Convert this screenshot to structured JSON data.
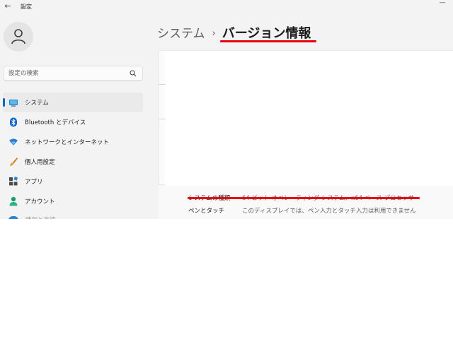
{
  "window": {
    "title": "設定",
    "back_glyph": "←",
    "minimize_glyph": "—"
  },
  "search": {
    "placeholder": "設定の検索"
  },
  "sidebar": {
    "items": [
      {
        "label": "システム",
        "icon": "monitor-icon",
        "selected": true
      },
      {
        "label": "Bluetooth とデバイス",
        "icon": "bluetooth-icon"
      },
      {
        "label": "ネットワークとインターネット",
        "icon": "wifi-icon"
      },
      {
        "label": "個人用設定",
        "icon": "brush-icon"
      },
      {
        "label": "アプリ",
        "icon": "apps-icon"
      },
      {
        "label": "アカウント",
        "icon": "person-icon"
      },
      {
        "label": "時刻と言語",
        "icon": "clock-globe-icon"
      }
    ]
  },
  "breadcrumb": {
    "parent": "システム",
    "separator": "›",
    "current": "バージョン情報"
  },
  "specs": [
    {
      "key": "システムの種類",
      "value": "64 ビット オペレーティング システム、x64 ベース プロセッサ"
    },
    {
      "key": "ペンとタッチ",
      "value": "このディスプレイでは、ペン入力とタッチ入力は利用できません"
    }
  ],
  "colors": {
    "accent": "#0067c0",
    "annotation": "#e60012",
    "background": "#f3f3f3"
  }
}
